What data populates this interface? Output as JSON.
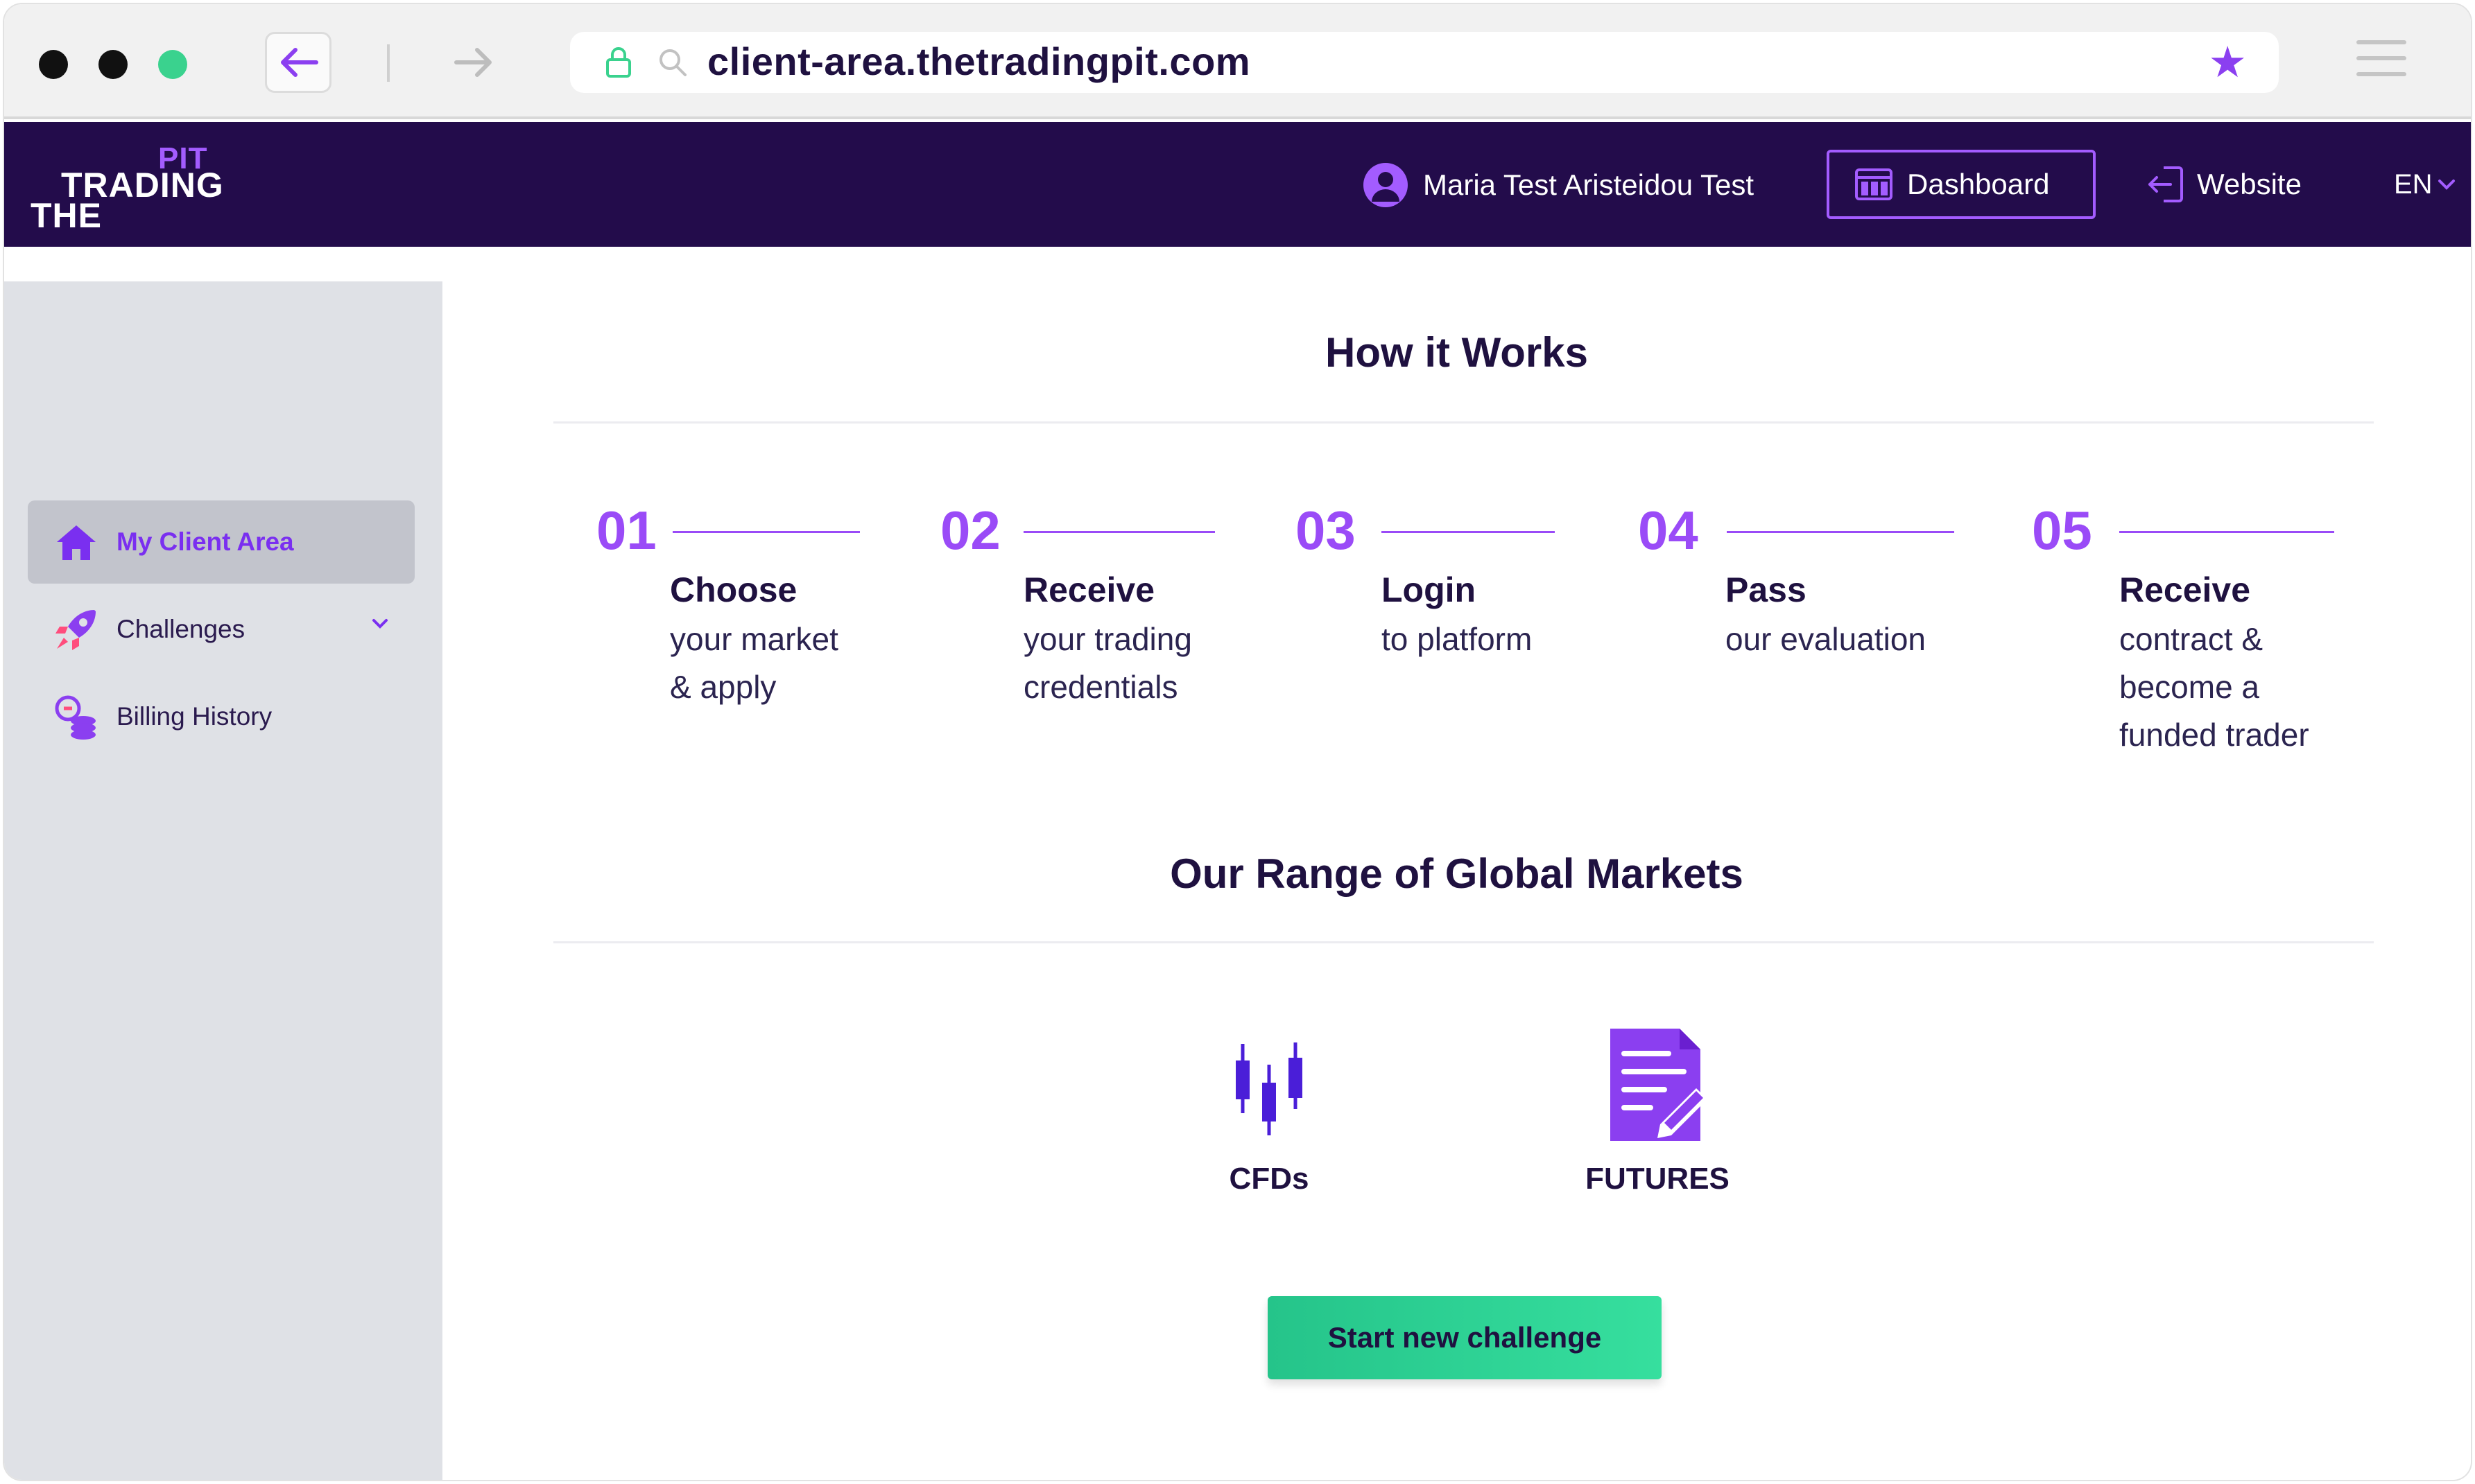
{
  "browser": {
    "url": "client-area.thetradingpit.com"
  },
  "header": {
    "logo": {
      "line1": "PIT",
      "line2": "TRADING",
      "line3": "THE"
    },
    "user_name": "Maria Test Aristeidou Test",
    "dashboard_label": "Dashboard",
    "website_label": "Website",
    "language": "EN"
  },
  "sidebar": {
    "items": [
      {
        "label": "My Client Area",
        "icon": "home-icon",
        "active": true
      },
      {
        "label": "Challenges",
        "icon": "rocket-icon",
        "active": false
      },
      {
        "label": "Billing History",
        "icon": "coins-icon",
        "active": false
      }
    ]
  },
  "how_it_works": {
    "title": "How it Works",
    "steps": [
      {
        "num": "01",
        "title": "Choose",
        "desc": [
          "your market",
          "& apply"
        ]
      },
      {
        "num": "02",
        "title": "Receive",
        "desc": [
          "your trading",
          "credentials"
        ]
      },
      {
        "num": "03",
        "title": "Login",
        "desc": [
          "to platform"
        ]
      },
      {
        "num": "04",
        "title": "Pass",
        "desc": [
          "our evaluation"
        ]
      },
      {
        "num": "05",
        "title": "Receive",
        "desc": [
          "contract &",
          "become a",
          "funded trader"
        ]
      }
    ]
  },
  "markets": {
    "title": "Our Range of Global Markets",
    "items": [
      {
        "label": "CFDs",
        "icon": "candlestick-chart-icon"
      },
      {
        "label": "FUTURES",
        "icon": "document-edit-icon"
      }
    ]
  },
  "cta_label": "Start new challenge",
  "colors": {
    "header_bg": "#230c4b",
    "accent_purple": "#9a4bf7",
    "cta_green": "#2ed596",
    "sidebar_bg": "#dfe1e6"
  }
}
